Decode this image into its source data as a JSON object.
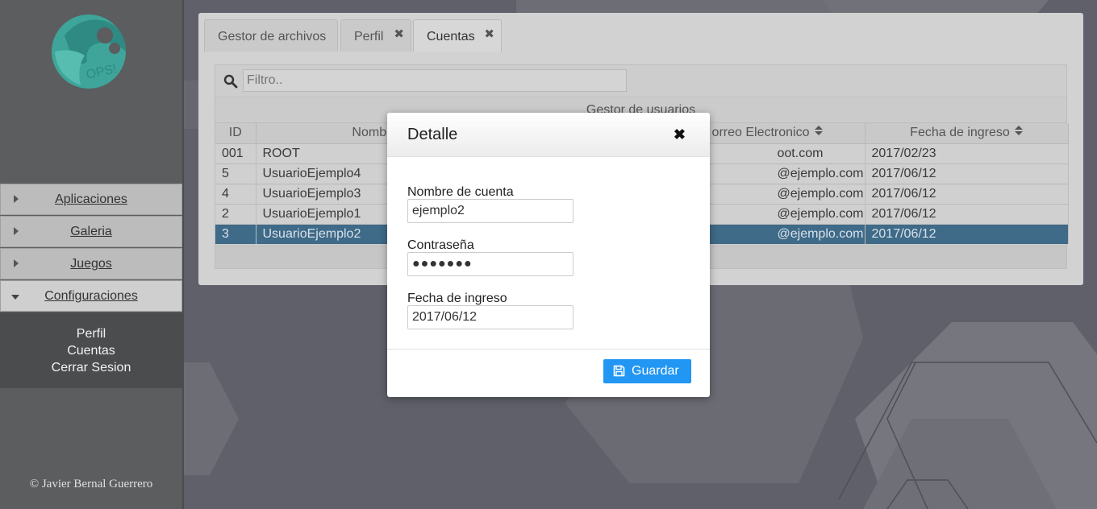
{
  "sidebar": {
    "logo_text": "OPS!",
    "menu": [
      {
        "label": "Aplicaciones",
        "open": false
      },
      {
        "label": "Galeria",
        "open": false
      },
      {
        "label": "Juegos",
        "open": false
      },
      {
        "label": "Configuraciones",
        "open": true
      }
    ],
    "submenu": [
      "Perfil",
      "Cuentas",
      "Cerrar Sesion"
    ],
    "copyright": "© Javier Bernal Guerrero"
  },
  "tabs": [
    {
      "label": "Gestor de archivos",
      "closable": false
    },
    {
      "label": "Perfil",
      "closable": true
    },
    {
      "label": "Cuentas",
      "closable": true,
      "active": true
    }
  ],
  "grid": {
    "filter_placeholder": "Filtro..",
    "caption": "Gestor de usuarios",
    "columns": [
      "ID",
      "Nombre de perfil",
      "Correo Electronico",
      "Fecha de ingreso"
    ],
    "column_headers_visible": [
      "ID",
      "Nombre de perf",
      "orreo Electronico",
      "Fecha de ingreso"
    ],
    "rows": [
      {
        "id": "001",
        "name": "ROOT",
        "email": "oot.com",
        "date": "2017/02/23",
        "selected": false
      },
      {
        "id": "5",
        "name": "UsuarioEjemplo4",
        "email": "@ejemplo.com",
        "date": "2017/06/12",
        "selected": false
      },
      {
        "id": "4",
        "name": "UsuarioEjemplo3",
        "email": "@ejemplo.com",
        "date": "2017/06/12",
        "selected": false
      },
      {
        "id": "2",
        "name": "UsuarioEjemplo1",
        "email": "@ejemplo.com",
        "date": "2017/06/12",
        "selected": false
      },
      {
        "id": "3",
        "name": "UsuarioEjemplo2",
        "email": "@ejemplo.com",
        "date": "2017/06/12",
        "selected": true
      }
    ]
  },
  "modal": {
    "title": "Detalle",
    "close_icon": "close-icon",
    "fields": {
      "account_label": "Nombre de cuenta",
      "account_value": "ejemplo2",
      "password_label": "Contraseña",
      "password_value": "●●●●●●●",
      "date_label": "Fecha de ingreso",
      "date_value": "2017/06/12"
    },
    "save_label": "Guardar",
    "save_color": "#2196f3"
  },
  "colors": {
    "selected_row": "#3f6a88",
    "sidebar": "#5b5d5f",
    "logo": "#3fa59a"
  }
}
